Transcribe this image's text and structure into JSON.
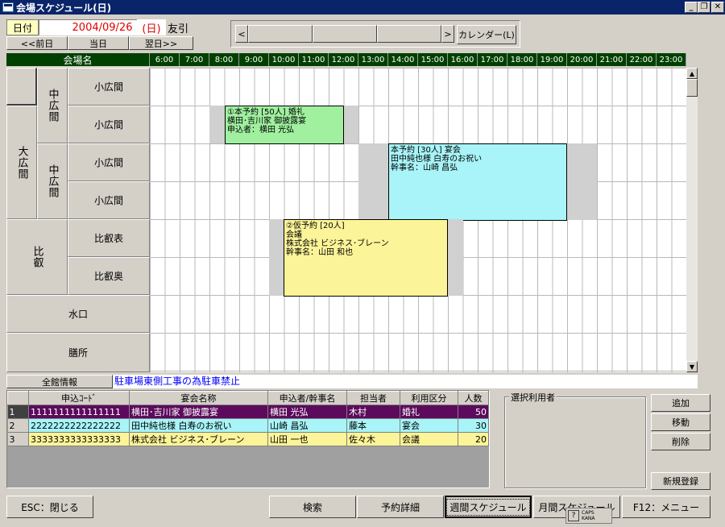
{
  "window": {
    "title": "会場スケジュール(日)",
    "min_label": "_",
    "restore_label": "❐",
    "close_label": "✕"
  },
  "date_bar": {
    "label": "日付",
    "date": "2004/09/26",
    "weekday": "(日)",
    "rokuyo": "友引",
    "prev": "<<前日",
    "today": "当日",
    "next": "翌日>>"
  },
  "scroller": {
    "left": "<",
    "right": ">",
    "calendar_button": "カレンダー(L)"
  },
  "grid": {
    "venue_header": "会場名",
    "hours": [
      "6:00",
      "7:00",
      "8:00",
      "9:00",
      "10:00",
      "11:00",
      "12:00",
      "13:00",
      "14:00",
      "15:00",
      "16:00",
      "17:00",
      "18:00",
      "19:00",
      "20:00",
      "21:00",
      "22:00",
      "23:00"
    ],
    "halls": {
      "big": "大広間",
      "mid1": "中広間",
      "mid2": "中広間",
      "hiei": "比叡"
    },
    "rooms": [
      "小広間",
      "小広間",
      "小広間",
      "小広間",
      "比叡表",
      "比叡奥",
      "水口",
      "膳所"
    ],
    "scroll_up": "▲",
    "scroll_down": "▼"
  },
  "bookings": [
    {
      "text": "①本予約 [50人] 婚礼\n横田･吉川家 御披露宴\n申込者：横田 光弘",
      "color": "#a0f0a0"
    },
    {
      "text": "本予約 [30人] 宴会\n田中純也様 白寿のお祝い\n幹事名：山崎 昌弘",
      "color": "#a8f4f8"
    },
    {
      "text": "②仮予約 [20人]\n会議\n株式会社 ビジネス･ブレーン\n幹事名：山田 和也",
      "color": "#fcf498"
    }
  ],
  "info": {
    "tab": "全館情報",
    "message": "駐車場東側工事の為駐車禁止"
  },
  "table": {
    "headers": [
      "申込ｺｰﾄﾞ",
      "宴会名称",
      "申込者/幹事名",
      "担当者",
      "利用区分",
      "人数"
    ],
    "rows": [
      {
        "no": "1",
        "code": "1111111111111111",
        "name": "横田･吉川家 御披露宴",
        "applicant": "横田 光弘",
        "staff": "木村",
        "type": "婚礼",
        "count": "50"
      },
      {
        "no": "2",
        "code": "2222222222222222",
        "name": "田中純也様 白寿のお祝い",
        "applicant": "山崎 昌弘",
        "staff": "藤本",
        "type": "宴会",
        "count": "30"
      },
      {
        "no": "3",
        "code": "3333333333333333",
        "name": "株式会社 ビジネス･ブレーン",
        "applicant": "山田 一也",
        "staff": "佐々木",
        "type": "会議",
        "count": "20"
      }
    ]
  },
  "selected_users": {
    "label": "選択利用者"
  },
  "side_buttons": {
    "add": "追加",
    "move": "移動",
    "delete": "削除",
    "new": "新規登録"
  },
  "bottom": {
    "esc": "ESC：閉じる",
    "search": "検索",
    "detail": "予約詳細",
    "weekly": "週間スケジュール",
    "monthly": "月間スケジュール",
    "menu": "F12：メニュー"
  },
  "ime": {
    "help": "?",
    "caps": "CAPS",
    "kana": "KANA"
  }
}
